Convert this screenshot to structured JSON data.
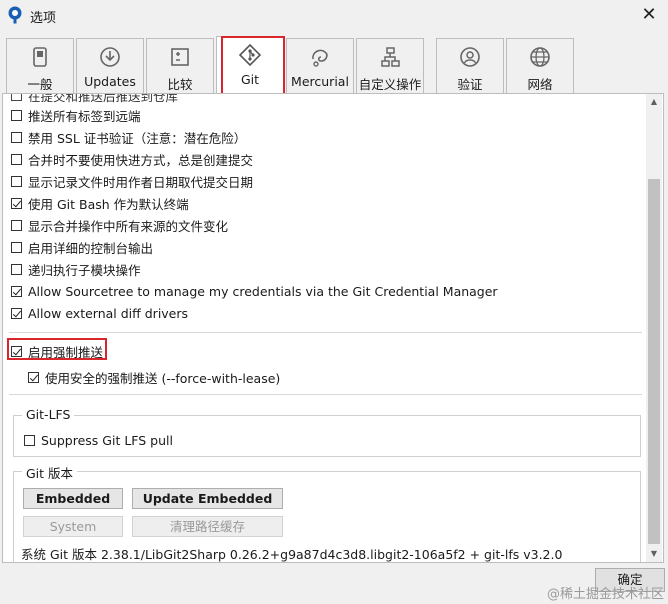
{
  "window": {
    "title": "选项",
    "close_glyph": "✕"
  },
  "tabs": [
    {
      "label": "一般",
      "icon": "switch-icon"
    },
    {
      "label": "Updates",
      "icon": "download-icon"
    },
    {
      "label": "比较",
      "icon": "diff-icon"
    },
    {
      "label": "Git",
      "icon": "git-icon",
      "active": true
    },
    {
      "label": "Mercurial",
      "icon": "mercurial-icon"
    },
    {
      "label": "自定义操作",
      "icon": "custom-action-icon"
    },
    {
      "label": "验证",
      "icon": "user-icon"
    },
    {
      "label": "网络",
      "icon": "globe-icon"
    }
  ],
  "options": [
    {
      "label": "在提交和推送后推送到仓库",
      "checked": false
    },
    {
      "label": "推送所有标签到远端",
      "checked": false
    },
    {
      "label": "禁用 SSL 证书验证（注意：潜在危险）",
      "checked": false
    },
    {
      "label": "合并时不要使用快进方式，总是创建提交",
      "checked": false
    },
    {
      "label": "显示记录文件时用作者日期取代提交日期",
      "checked": false
    },
    {
      "label": "使用 Git Bash 作为默认终端",
      "checked": true
    },
    {
      "label": "显示合并操作中所有来源的文件变化",
      "checked": false
    },
    {
      "label": "启用详细的控制台输出",
      "checked": false
    },
    {
      "label": "递归执行子模块操作",
      "checked": false
    },
    {
      "label": "Allow Sourcetree to manage my credentials via the Git Credential Manager",
      "checked": true
    },
    {
      "label": "Allow external diff drivers",
      "checked": true
    }
  ],
  "force_push": {
    "label": "启用强制推送",
    "checked": true
  },
  "safe_force_push": {
    "label": "使用安全的强制推送 (--force-with-lease)",
    "checked": true
  },
  "git_lfs": {
    "title": "Git-LFS",
    "suppress_label": "Suppress Git LFS pull",
    "checked": false
  },
  "git_version": {
    "title": "Git 版本",
    "embedded": "Embedded",
    "update_embedded": "Update Embedded",
    "system": "System",
    "clear_cache": "清理路径缓存",
    "info": "系统 Git 版本 2.38.1/LibGit2Sharp 0.26.2+g9a87d4c3d8.libgit2-106a5f2 + git-lfs v3.2.0"
  },
  "ok_label": "确定",
  "watermark": "@稀土掘金技术社区",
  "colors": {
    "highlight": "#d9262d",
    "panel": "#ffffff",
    "chrome": "#f0f0f0"
  }
}
